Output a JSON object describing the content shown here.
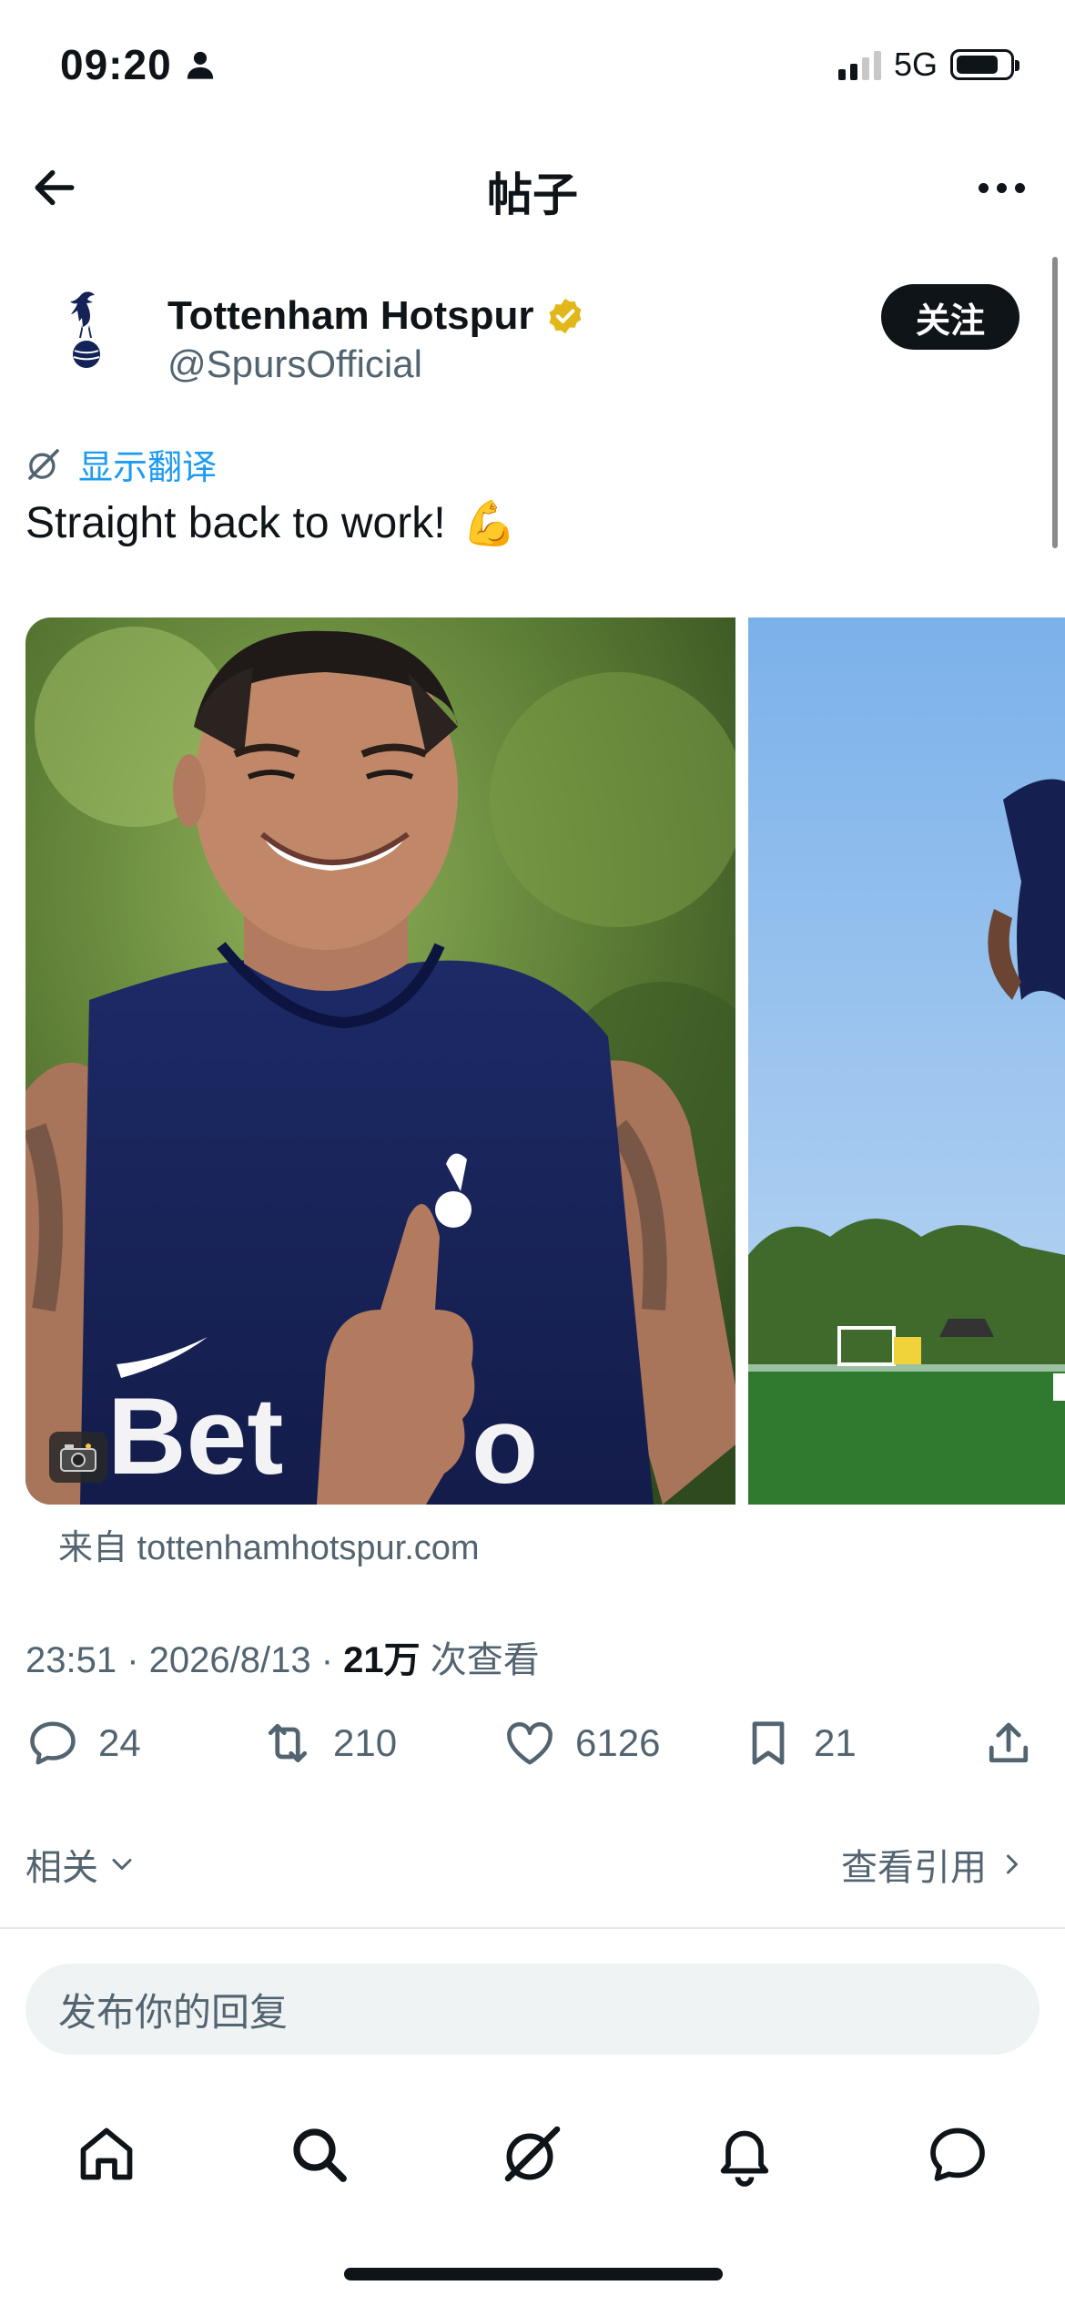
{
  "status_bar": {
    "time": "09:20",
    "network": "5G"
  },
  "header": {
    "title": "帖子"
  },
  "post": {
    "author_name": "Tottenham Hotspur",
    "author_handle": "@SpursOfficial",
    "follow_label": "关注",
    "translate_label": "显示翻译",
    "text": "Straight back to work!",
    "emoji": "💪",
    "source": "来自 tottenhamhotspur.com",
    "timestamp": "23:51 · 2026/8/13 · ",
    "views_count": "21万",
    "views_label": " 次查看"
  },
  "actions": {
    "replies": "24",
    "retweets": "210",
    "likes": "6126",
    "bookmarks": "21"
  },
  "related": {
    "label": "相关",
    "view_quotes": "查看引用"
  },
  "reply": {
    "placeholder": "发布你的回复"
  },
  "colors": {
    "accent": "#1d9bf0",
    "verified_gold": "#e2b719",
    "text_secondary": "#536471",
    "spurs_navy": "#132257"
  },
  "tabs": [
    "home-icon",
    "search-icon",
    "grok-icon",
    "notifications-icon",
    "messages-icon"
  ]
}
